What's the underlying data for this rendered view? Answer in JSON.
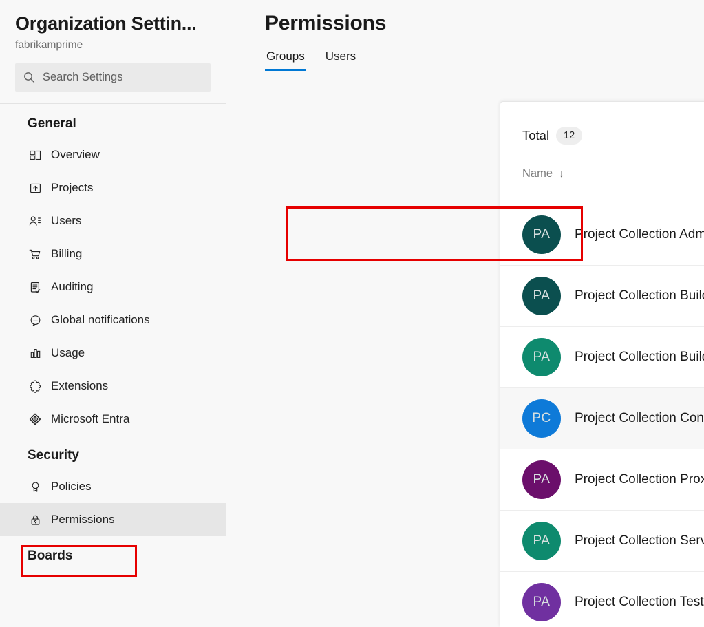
{
  "sidebar": {
    "org_title": "Organization Settin...",
    "org_name": "fabrikamprime",
    "search": {
      "placeholder": "Search Settings",
      "value": "",
      "icon": "search-icon"
    },
    "sections": [
      {
        "title": "General",
        "items": [
          {
            "label": "Overview",
            "icon": "overview-grid-icon",
            "selected": false
          },
          {
            "label": "Projects",
            "icon": "projects-upload-icon",
            "selected": false
          },
          {
            "label": "Users",
            "icon": "users-people-icon",
            "selected": false
          },
          {
            "label": "Billing",
            "icon": "billing-cart-icon",
            "selected": false
          },
          {
            "label": "Auditing",
            "icon": "auditing-clipboard-check-icon",
            "selected": false
          },
          {
            "label": "Global notifications",
            "icon": "global-notifications-bell-icon",
            "selected": false
          },
          {
            "label": "Usage",
            "icon": "usage-bar-chart-icon",
            "selected": false
          },
          {
            "label": "Extensions",
            "icon": "extensions-puzzle-icon",
            "selected": false
          },
          {
            "label": "Microsoft Entra",
            "icon": "microsoft-entra-diamond-icon",
            "selected": false
          }
        ]
      },
      {
        "title": "Security",
        "items": [
          {
            "label": "Policies",
            "icon": "policies-ribbon-icon",
            "selected": false
          },
          {
            "label": "Permissions",
            "icon": "permissions-lock-icon",
            "selected": true
          }
        ]
      },
      {
        "title": "Boards",
        "items": []
      }
    ]
  },
  "main": {
    "page_title": "Permissions",
    "tabs": [
      {
        "label": "Groups",
        "active": true
      },
      {
        "label": "Users",
        "active": false
      }
    ],
    "total_label": "Total",
    "total_count": "12",
    "column_header": "Name",
    "sort_arrow": "↓",
    "groups": [
      {
        "initials": "PA",
        "name": "Project Collection Administrators",
        "color": "#0b4f4f",
        "hover": false
      },
      {
        "initials": "PA",
        "name": "Project Collection Build Administrators",
        "color": "#0b4f4f",
        "hover": false
      },
      {
        "initials": "PA",
        "name": "Project Collection Build Service Accounts",
        "color": "#0e8a6e",
        "hover": false
      },
      {
        "initials": "PC",
        "name": "Project Collection Contributors",
        "color": "#0e7ad8",
        "hover": true
      },
      {
        "initials": "PA",
        "name": "Project Collection Proxy Service Accounts",
        "color": "#6b0f6b",
        "hover": false
      },
      {
        "initials": "PA",
        "name": "Project Collection Service Accounts",
        "color": "#0e8a6e",
        "hover": false
      },
      {
        "initials": "PA",
        "name": "Project Collection Test Service Accounts",
        "color": "#7030a0",
        "hover": false
      }
    ]
  },
  "annotations": {
    "accent_color": "#e60000",
    "tab_accent_color": "#0078d4",
    "permissions_box": "permissions-sidebar-highlight",
    "first_row_box": "project-collection-administrators-highlight"
  }
}
